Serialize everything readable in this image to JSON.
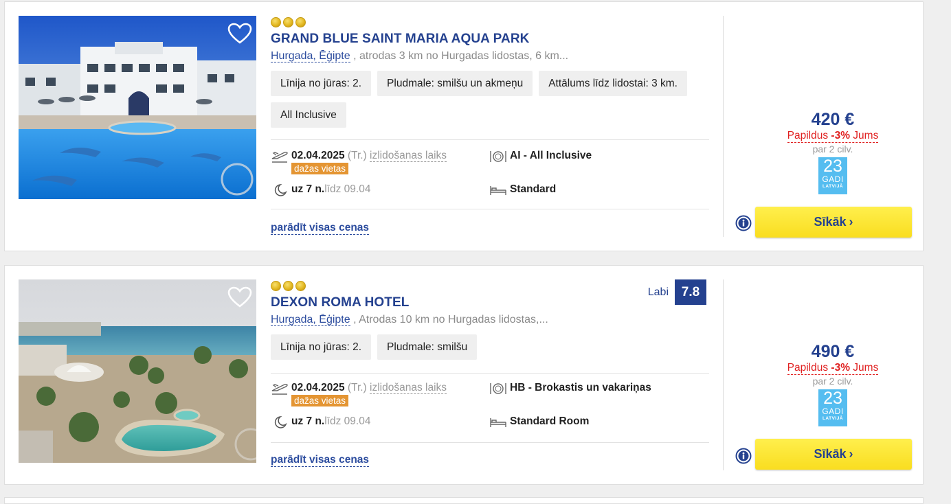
{
  "hotels": [
    {
      "name": "GRAND BLUE SAINT MARIA AQUA PARK",
      "stars": 3,
      "location_link": "Hurgada, Ēģipte",
      "location_desc": " , atrodas 3 km no Hurgadas lidostas, 6 km...",
      "tags": [
        "Līnija no jūras: 2.",
        "Pludmale: smilšu un akmeņu",
        "Attālums līdz lidostai: 3 km.",
        "All Inclusive"
      ],
      "date": "02.04.2025",
      "weekday": " (Tr.) ",
      "departure_label": "izlidošanas laiks",
      "seats_badge": "dažas vietas",
      "nights": "uz 7 n.",
      "until": " līdz 09.04",
      "meal": "AI - All Inclusive",
      "room": "Standard",
      "show_prices": "parādīt visas cenas",
      "price": "420 €",
      "discount_pre": "Papildus ",
      "discount_val": "-3%",
      "discount_post": " Jums",
      "persons": "par 2 cilv.",
      "badge_num": "23",
      "badge_gadi": "GADI",
      "badge_lv": "LATVIJĀ",
      "more": "Sīkāk"
    },
    {
      "name": "DEXON ROMA HOTEL",
      "stars": 3,
      "rating_label": "Labi",
      "rating": "7.8",
      "location_link": "Hurgada, Ēģipte",
      "location_desc": " , Atrodas 10 km no Hurgadas lidostas,...",
      "tags": [
        "Līnija no jūras: 2.",
        "Pludmale: smilšu"
      ],
      "date": "02.04.2025",
      "weekday": " (Tr.) ",
      "departure_label": "izlidošanas laiks",
      "seats_badge": "dažas vietas",
      "nights": "uz 7 n.",
      "until": " līdz 09.04",
      "meal": "HB - Brokastis un vakariņas",
      "room": "Standard Room",
      "show_prices": "parādīt visas cenas",
      "price": "490 €",
      "discount_pre": "Papildus ",
      "discount_val": "-3%",
      "discount_post": " Jums",
      "persons": "par 2 cilv.",
      "badge_num": "23",
      "badge_gadi": "GADI",
      "badge_lv": "LATVIJĀ",
      "more": "Sīkāk"
    }
  ],
  "icons": {
    "favorite": "heart-outline-icon",
    "departure": "plane-takeoff-icon",
    "nights": "moon-icon",
    "meal": "plate-cutlery-icon",
    "room": "bed-icon",
    "info": "info-circle-icon",
    "more": "chevron-right-icon"
  },
  "colors": {
    "brand_blue": "#24418f",
    "discount_red": "#e02020",
    "seats_orange": "#e49533",
    "button_yellow": "#f9dd20",
    "badge_blue": "#55bdf0"
  }
}
